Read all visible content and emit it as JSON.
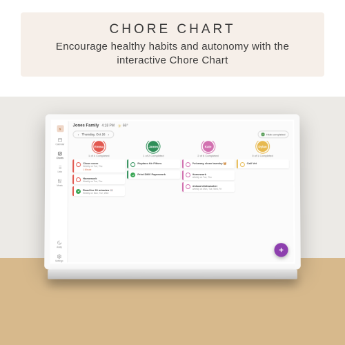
{
  "hero": {
    "title": "CHORE CHART",
    "subtitle": "Encourage healthy habits and autonomy with the interactive Chore Chart"
  },
  "header": {
    "avatar_initial": "S",
    "family_name": "Jones Family",
    "time": "4:18 PM",
    "temp": "66°"
  },
  "sidebar": {
    "items": [
      {
        "label": "Calendar",
        "icon": "calendar-icon"
      },
      {
        "label": "Chores",
        "icon": "checklist-icon"
      },
      {
        "label": "Lists",
        "icon": "list-icon"
      },
      {
        "label": "Meals",
        "icon": "meals-icon"
      }
    ],
    "bottom": [
      {
        "label": "Away",
        "icon": "moon-icon"
      },
      {
        "label": "Settings",
        "icon": "gear-icon"
      }
    ]
  },
  "datebar": {
    "date_label": "Thursday, Oct 26",
    "hide_label": "Hide completed"
  },
  "columns": [
    {
      "name": "Emma",
      "color": "#e2584f",
      "count": "1 of 4 Completed",
      "cards": [
        {
          "title": "Clean room",
          "sub": "Weekly on Tue, Thu",
          "alert": "1 Minute",
          "status": "open"
        },
        {
          "title": "Homework",
          "sub": "Weekly on Tue, Thu",
          "status": "open"
        },
        {
          "title": "Read for 20 minutes 📖",
          "sub": "Weekly on Mon, Tue, Wed",
          "status": "done"
        }
      ]
    },
    {
      "name": "James",
      "color": "#2f8f59",
      "count": "1 of 2 Completed",
      "cards": [
        {
          "title": "Replace Air Filters",
          "sub": "",
          "status": "open"
        },
        {
          "title": "Print DMV Paperwork",
          "sub": "",
          "status": "done"
        }
      ]
    },
    {
      "name": "Kate",
      "color": "#d271b0",
      "count": "2 of 6 Completed",
      "cards": [
        {
          "title": "Put away clean laundry 🧺",
          "sub": "",
          "status": "open"
        },
        {
          "title": "Homework",
          "sub": "Weekly on Tue, Thu",
          "status": "open"
        },
        {
          "title": "Unload dishwasher",
          "sub": "Weekly on Mon, Tue, Wed, Fri",
          "status": "open"
        }
      ]
    },
    {
      "name": "Dylan",
      "color": "#e7b94f",
      "count": "0 of 1 Completed",
      "cards": [
        {
          "title": "Call Vet",
          "sub": "",
          "status": "open"
        }
      ]
    }
  ],
  "fab_color": "#8d3fae"
}
